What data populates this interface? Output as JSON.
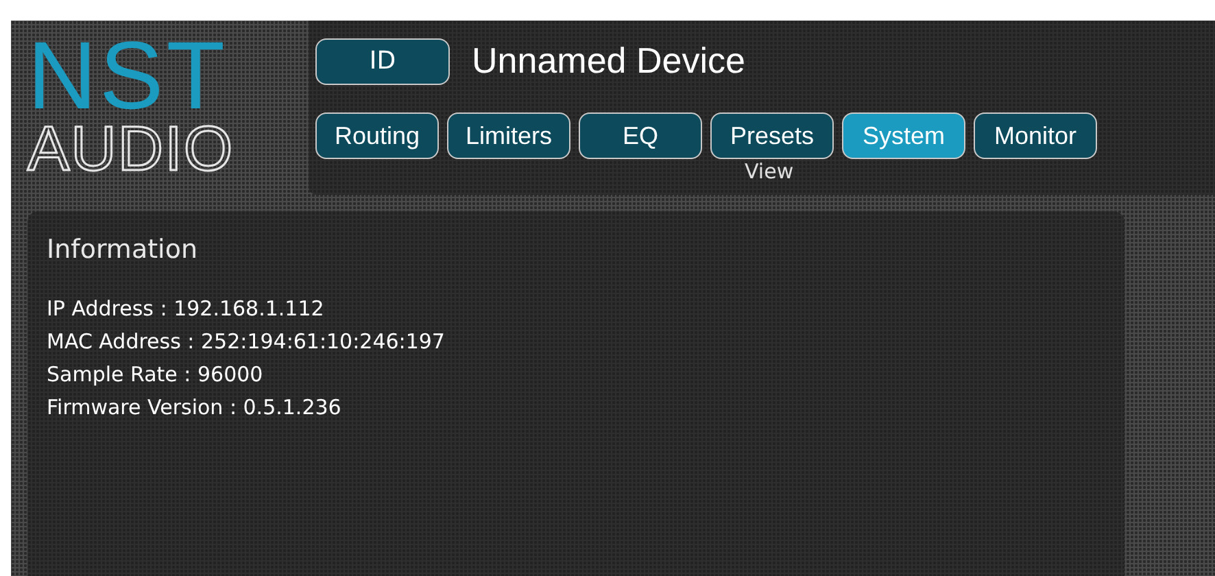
{
  "logo": {
    "top": "NST",
    "bottom": "AUDIO"
  },
  "id_button": {
    "label": "ID"
  },
  "device_name": "Unnamed Device",
  "tabs": [
    {
      "label": "Routing",
      "selected": false
    },
    {
      "label": "Limiters",
      "selected": false
    },
    {
      "label": "EQ",
      "selected": false
    },
    {
      "label": "Presets",
      "selected": false
    },
    {
      "label": "System",
      "selected": true
    },
    {
      "label": "Monitor",
      "selected": false
    }
  ],
  "tabs_caption": "View",
  "information": {
    "title": "Information",
    "lines": [
      "IP Address : 192.168.1.112",
      "MAC Address : 252:194:61:10:246:197",
      "Sample Rate : 96000",
      "Firmware Version : 0.5.1.236"
    ]
  }
}
